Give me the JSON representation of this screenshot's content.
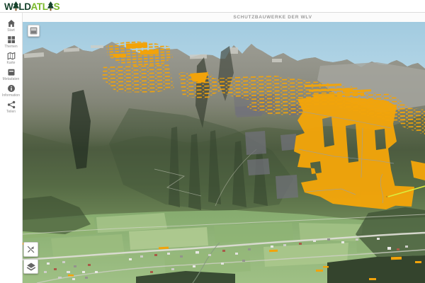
{
  "app": {
    "logo": {
      "part1": "W",
      "part2": "LD",
      "part3": "ATL",
      "part4": "S",
      "full": "WALDATLAS"
    },
    "title": "SCHUTZBAUWERKE DER WLV"
  },
  "sidebar": {
    "items": [
      {
        "label": "Start",
        "icon": "home-icon"
      },
      {
        "label": "Themen",
        "icon": "grid-icon"
      },
      {
        "label": "Karte",
        "icon": "map-icon"
      },
      {
        "label": "Metadaten",
        "icon": "archive-icon"
      },
      {
        "label": "Information",
        "icon": "info-icon"
      },
      {
        "label": "Teilen",
        "icon": "share-icon"
      }
    ]
  },
  "map": {
    "controls": [
      "minimap-toggle",
      "compass-disabled",
      "layers"
    ],
    "colors": {
      "sky": "#a6cde1",
      "structures_orange": "#f2a30a",
      "overlay_gray": "#71717b",
      "highlight_line": "#dbec3e"
    }
  },
  "brand": {
    "dark_green": "#17432c",
    "light_green": "#79b829",
    "trunk_brown": "#8a5a2a"
  }
}
